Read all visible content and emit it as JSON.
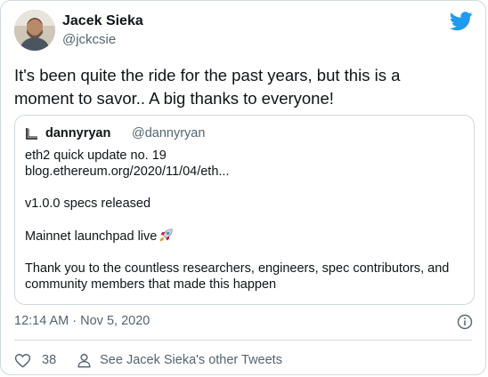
{
  "author": {
    "name": "Jacek Sieka",
    "handle": "@jckcsie"
  },
  "tweet": {
    "text": "It's been quite the ride for the past years, but this is a moment to savor.. A big thanks to everyone!"
  },
  "quote": {
    "name": "dannyryan",
    "handle": "@dannyryan",
    "line1": "eth2 quick update no. 19",
    "line2": "blog.ethereum.org/2020/11/04/eth...",
    "line3": "v1.0.0 specs released",
    "line4": "Mainnet launchpad live",
    "line5": "Thank you to the countless researchers, engineers, spec contributors, and community members that made this happen"
  },
  "meta": {
    "timestamp": "12:14 AM · Nov 5, 2020"
  },
  "actions": {
    "likes": "38",
    "other_tweets": "See Jacek Sieka's other Tweets"
  },
  "icons": {
    "brand": "twitter-bird-icon",
    "like": "heart-icon",
    "profile": "person-icon",
    "info": "info-icon",
    "emoji": "rocket-icon"
  },
  "colors": {
    "twitter_blue": "#1d9bf0",
    "secondary_text": "#536471",
    "border": "#cfd9de"
  }
}
